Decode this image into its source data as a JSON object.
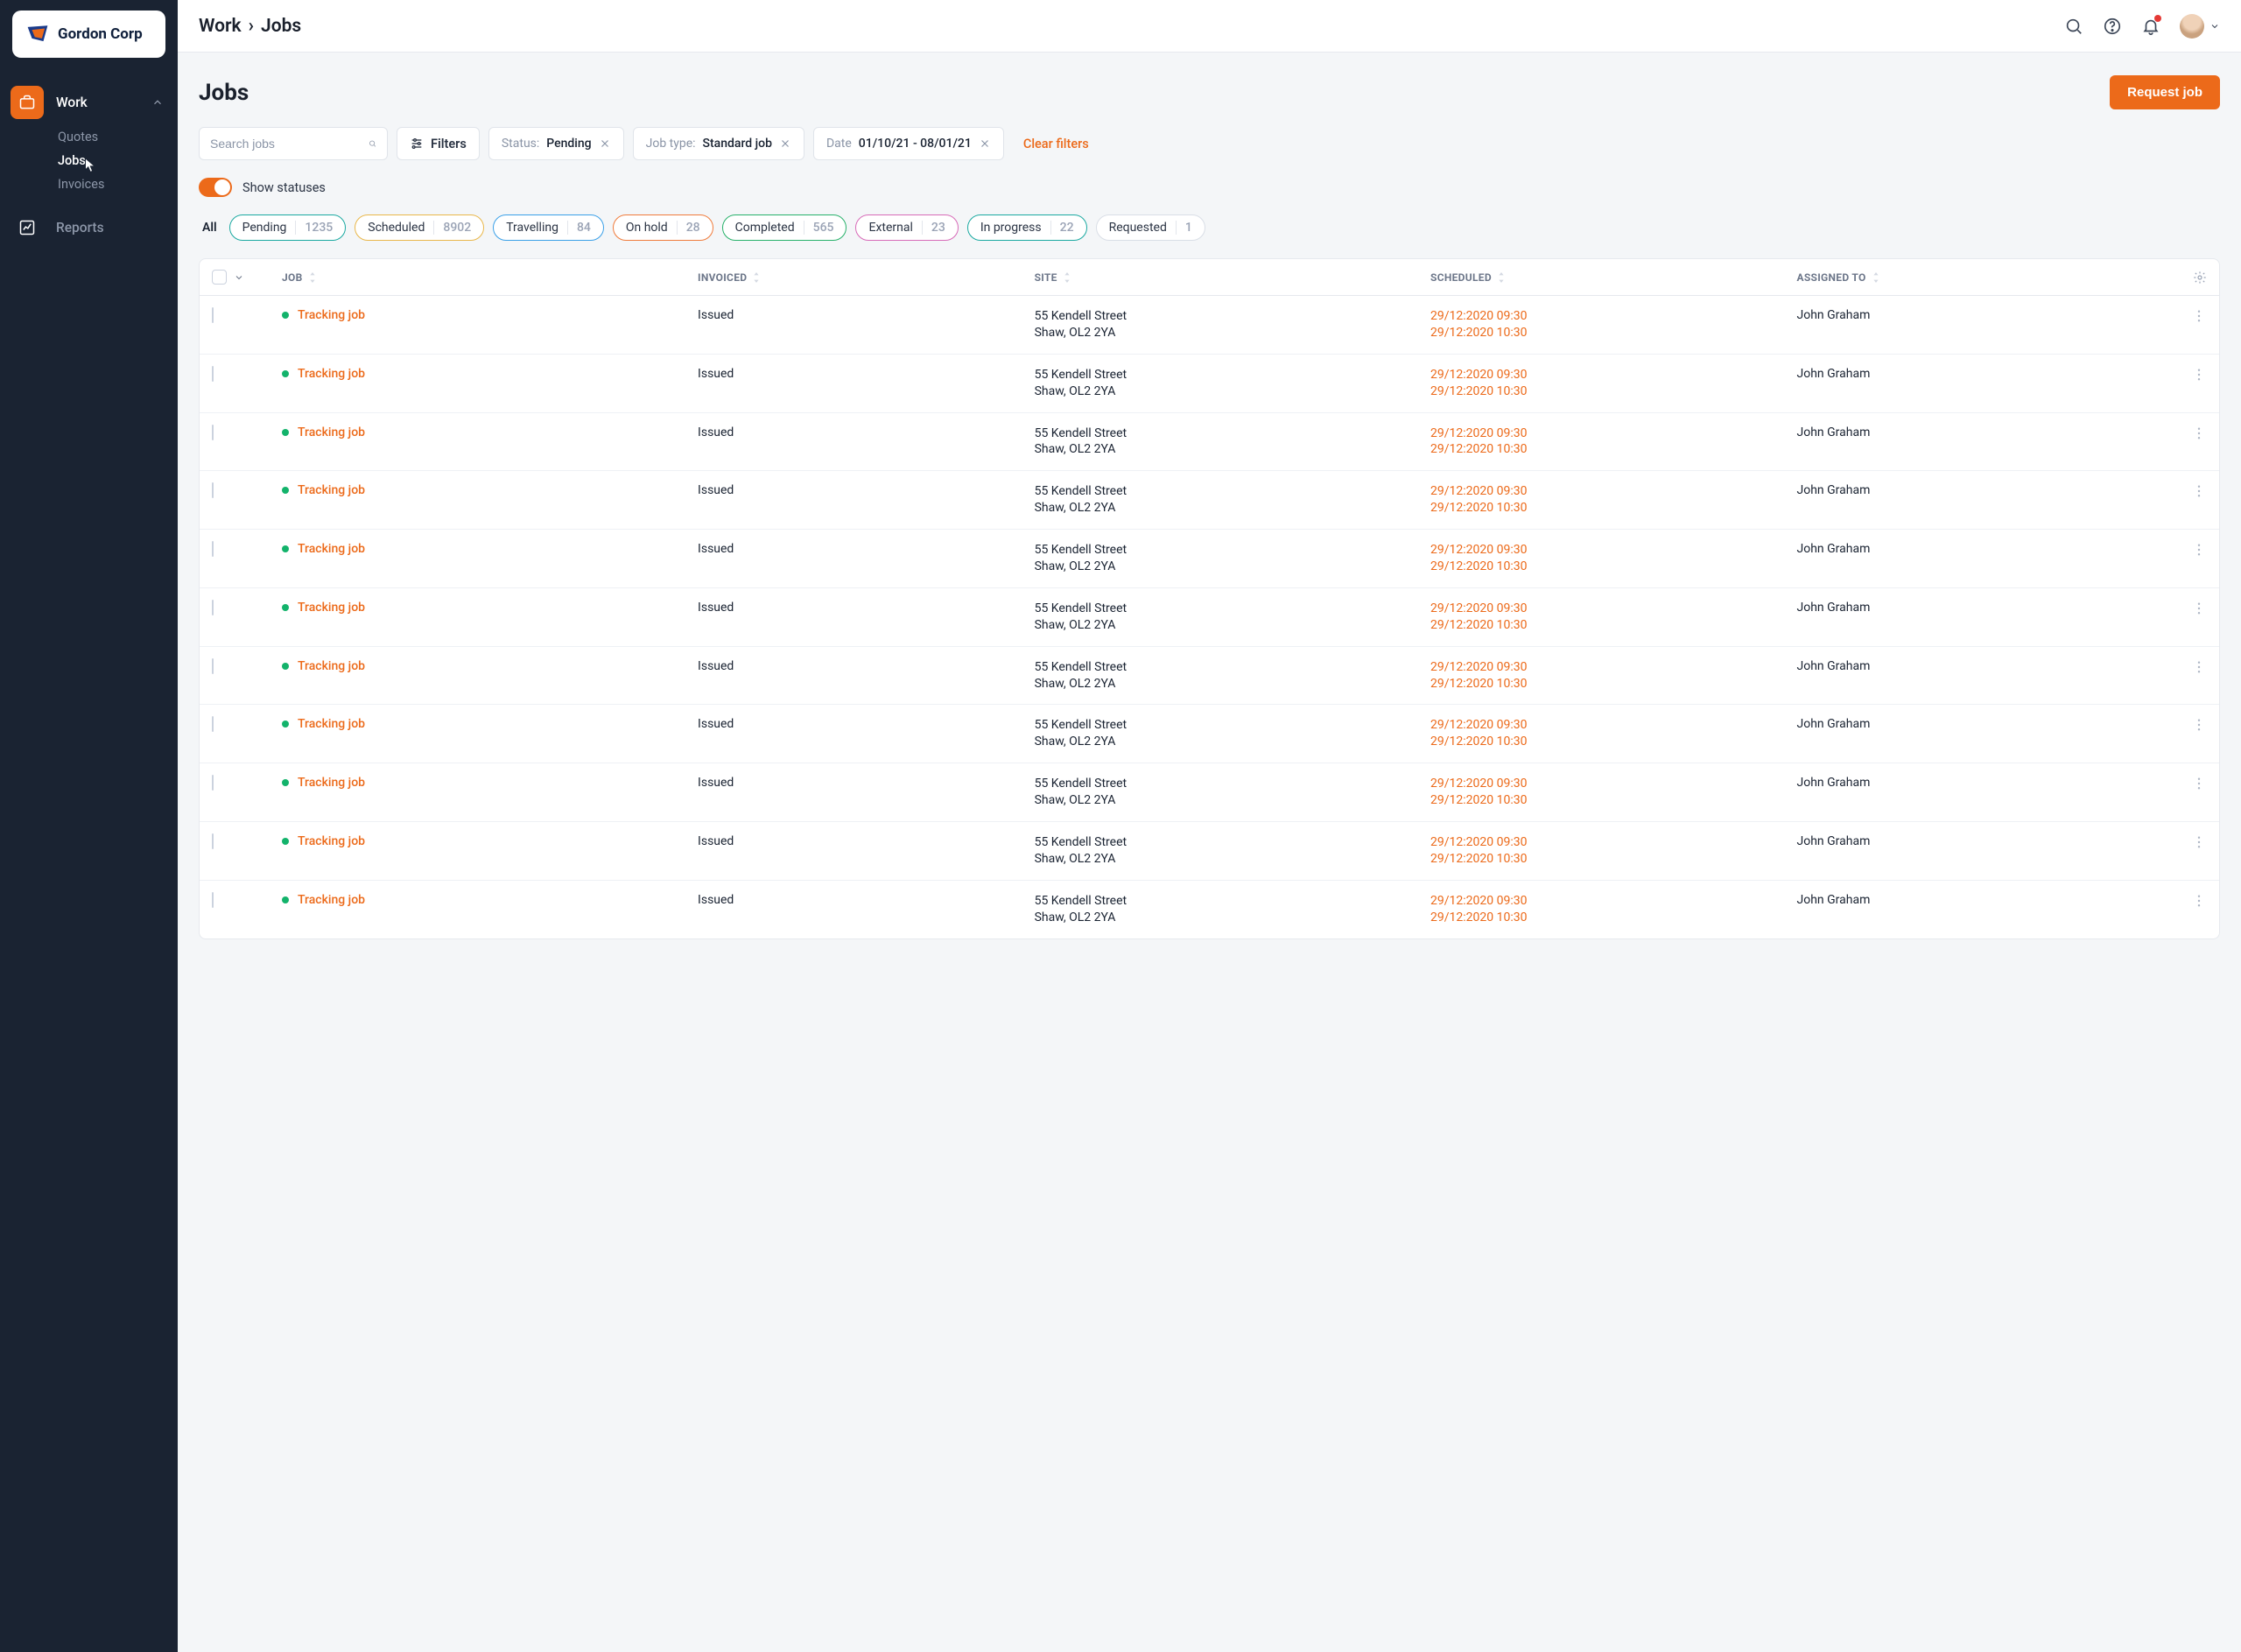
{
  "brand": {
    "name": "Gordon Corp"
  },
  "breadcrumb": {
    "section": "Work",
    "page": "Jobs"
  },
  "sidebar": {
    "items": [
      {
        "label": "Work",
        "expanded": true,
        "children": [
          {
            "label": "Quotes",
            "active": false
          },
          {
            "label": "Jobs",
            "active": true
          },
          {
            "label": "Invoices",
            "active": false
          }
        ]
      },
      {
        "label": "Reports",
        "expanded": false
      }
    ]
  },
  "page": {
    "title": "Jobs",
    "primary_action": "Request job",
    "search_placeholder": "Search jobs",
    "filters_label": "Filters",
    "clear_filters": "Clear filters",
    "filters": {
      "status": {
        "label": "Status:",
        "value": "Pending"
      },
      "jobtype": {
        "label": "Job type:",
        "value": "Standard job"
      },
      "date": {
        "label": "Date",
        "value": "01/10/21 - 08/01/21"
      }
    },
    "show_statuses_label": "Show statuses",
    "statuses": {
      "all_label": "All",
      "items": [
        {
          "name": "Pending",
          "count": "1235",
          "border": "#1aa9a1"
        },
        {
          "name": "Scheduled",
          "count": "8902",
          "border": "#e9b74a"
        },
        {
          "name": "Travelling",
          "count": "84",
          "border": "#3aa0e8"
        },
        {
          "name": "On hold",
          "count": "28",
          "border": "#f07b3b"
        },
        {
          "name": "Completed",
          "count": "565",
          "border": "#27b16a"
        },
        {
          "name": "External",
          "count": "23",
          "border": "#d76ab8"
        },
        {
          "name": "In progress",
          "count": "22",
          "border": "#1aa9a1"
        },
        {
          "name": "Requested",
          "count": "1",
          "border": "#d9dee6"
        }
      ]
    },
    "table": {
      "columns": {
        "job": "JOB",
        "invoiced": "INVOICED",
        "site": "SITE",
        "scheduled": "SCHEDULED",
        "assigned": "ASSIGNED TO"
      },
      "rows": [
        {
          "job": "Tracking job",
          "invoiced": "Issued",
          "site1": "55  Kendell Street",
          "site2": "Shaw, OL2 2YA",
          "sch1": "29/12:2020 09:30",
          "sch2": "29/12:2020 10:30",
          "assigned": "John Graham"
        },
        {
          "job": "Tracking job",
          "invoiced": "Issued",
          "site1": "55  Kendell Street",
          "site2": "Shaw, OL2 2YA",
          "sch1": "29/12:2020 09:30",
          "sch2": "29/12:2020 10:30",
          "assigned": "John Graham"
        },
        {
          "job": "Tracking job",
          "invoiced": "Issued",
          "site1": "55  Kendell Street",
          "site2": "Shaw, OL2 2YA",
          "sch1": "29/12:2020 09:30",
          "sch2": "29/12:2020 10:30",
          "assigned": "John Graham"
        },
        {
          "job": "Tracking job",
          "invoiced": "Issued",
          "site1": "55  Kendell Street",
          "site2": "Shaw, OL2 2YA",
          "sch1": "29/12:2020 09:30",
          "sch2": "29/12:2020 10:30",
          "assigned": "John Graham"
        },
        {
          "job": "Tracking job",
          "invoiced": "Issued",
          "site1": "55  Kendell Street",
          "site2": "Shaw, OL2 2YA",
          "sch1": "29/12:2020 09:30",
          "sch2": "29/12:2020 10:30",
          "assigned": "John Graham"
        },
        {
          "job": "Tracking job",
          "invoiced": "Issued",
          "site1": "55  Kendell Street",
          "site2": "Shaw, OL2 2YA",
          "sch1": "29/12:2020 09:30",
          "sch2": "29/12:2020 10:30",
          "assigned": "John Graham"
        },
        {
          "job": "Tracking job",
          "invoiced": "Issued",
          "site1": "55  Kendell Street",
          "site2": "Shaw, OL2 2YA",
          "sch1": "29/12:2020 09:30",
          "sch2": "29/12:2020 10:30",
          "assigned": "John Graham"
        },
        {
          "job": "Tracking job",
          "invoiced": "Issued",
          "site1": "55  Kendell Street",
          "site2": "Shaw, OL2 2YA",
          "sch1": "29/12:2020 09:30",
          "sch2": "29/12:2020 10:30",
          "assigned": "John Graham"
        },
        {
          "job": "Tracking job",
          "invoiced": "Issued",
          "site1": "55  Kendell Street",
          "site2": "Shaw, OL2 2YA",
          "sch1": "29/12:2020 09:30",
          "sch2": "29/12:2020 10:30",
          "assigned": "John Graham"
        },
        {
          "job": "Tracking job",
          "invoiced": "Issued",
          "site1": "55  Kendell Street",
          "site2": "Shaw, OL2 2YA",
          "sch1": "29/12:2020 09:30",
          "sch2": "29/12:2020 10:30",
          "assigned": "John Graham"
        },
        {
          "job": "Tracking job",
          "invoiced": "Issued",
          "site1": "55  Kendell Street",
          "site2": "Shaw, OL2 2YA",
          "sch1": "29/12:2020 09:30",
          "sch2": "29/12:2020 10:30",
          "assigned": "John Graham"
        }
      ]
    }
  }
}
